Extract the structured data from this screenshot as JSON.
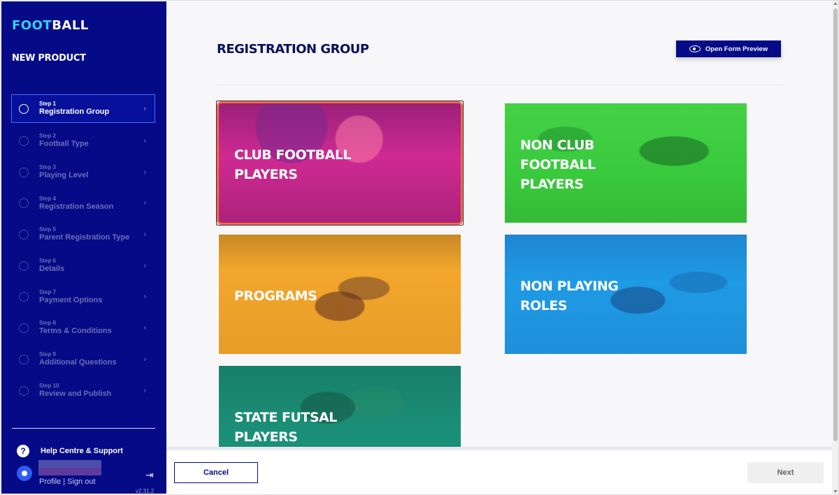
{
  "logo": {
    "part1": "FOOT",
    "part2": "BALL"
  },
  "sidebar": {
    "title": "NEW PRODUCT",
    "steps": [
      {
        "num": "Step 1",
        "name": "Registration Group",
        "state": "active"
      },
      {
        "num": "Step 2",
        "name": "Football Type",
        "state": "pending"
      },
      {
        "num": "Step 3",
        "name": "Playing Level",
        "state": "pending"
      },
      {
        "num": "Step 4",
        "name": "Registration Season",
        "state": "pending"
      },
      {
        "num": "Step 5",
        "name": "Parent Registration Type",
        "state": "pending"
      },
      {
        "num": "Step 6",
        "name": "Details",
        "state": "pending"
      },
      {
        "num": "Step 7",
        "name": "Payment Options",
        "state": "pending"
      },
      {
        "num": "Step 8",
        "name": "Terms & Conditions",
        "state": "pending"
      },
      {
        "num": "Step 9",
        "name": "Additional Questions",
        "state": "pending"
      },
      {
        "num": "Step 10",
        "name": "Review and Publish",
        "state": "pending"
      }
    ],
    "help_label": "Help Centre & Support",
    "profile_links": "Profile | Sign out",
    "version": "v2.31.2",
    "icons": {
      "step": "circle-icon",
      "chevron": "chevron-right-icon",
      "help": "question-icon",
      "avatar": "user-icon",
      "signout": "sign-out-icon"
    }
  },
  "main": {
    "page_title": "REGISTRATION GROUP",
    "preview_button": "Open Form Preview",
    "cards": [
      {
        "line1": "CLUB FOOTBALL",
        "line2": "PLAYERS",
        "line3": "",
        "color": "#d0268f",
        "selected": true
      },
      {
        "line1": "NON CLUB",
        "line2": "FOOTBALL",
        "line3": "PLAYERS",
        "color": "#36cc3b",
        "selected": false
      },
      {
        "line1": "PROGRAMS",
        "line2": "",
        "line3": "",
        "color": "#f2a52b",
        "selected": false
      },
      {
        "line1": "NON PLAYING",
        "line2": "ROLES",
        "line3": "",
        "color": "#1c96e3",
        "selected": false
      },
      {
        "line1": "STATE FUTSAL",
        "line2": "PLAYERS",
        "line3": "",
        "color": "#1a8e78",
        "selected": false
      }
    ]
  },
  "footer": {
    "cancel": "Cancel",
    "next": "Next"
  },
  "colors": {
    "sidebar": "#050a87",
    "accent": "#2ed3f5",
    "selected_outline": "#ff6a3d"
  }
}
